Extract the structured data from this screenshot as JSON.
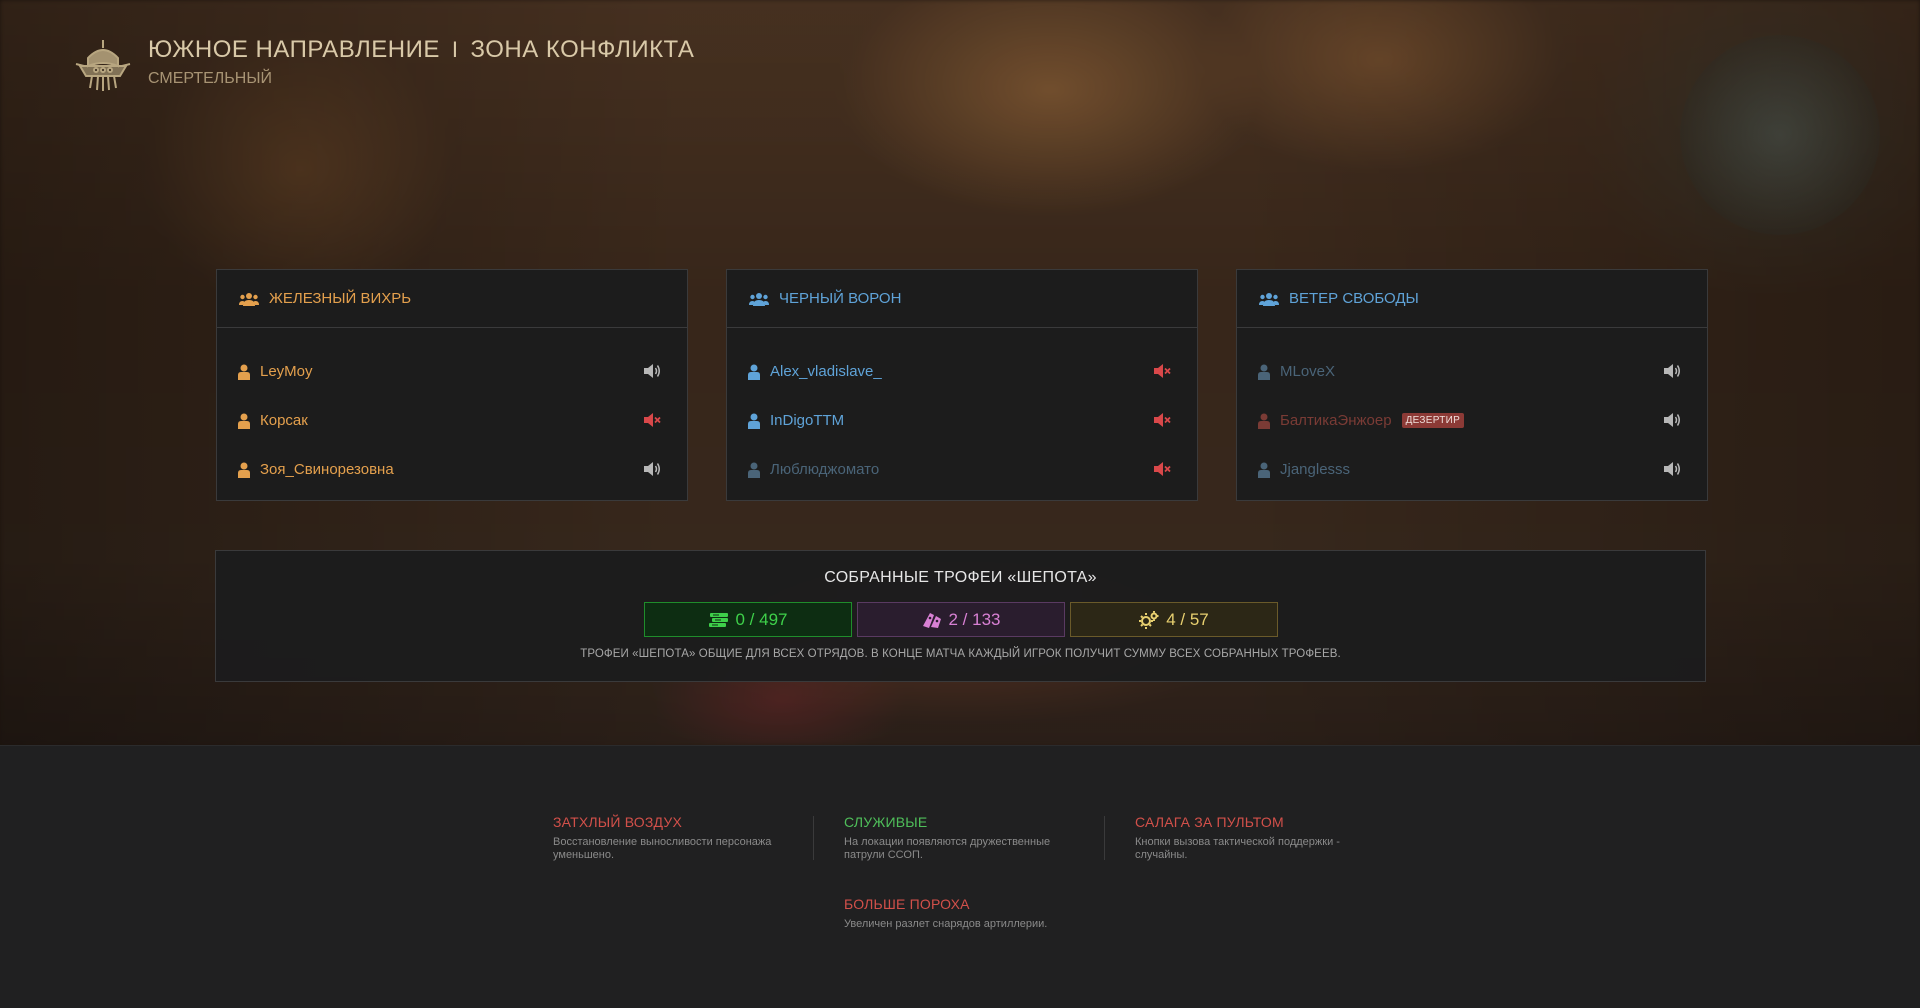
{
  "header": {
    "region": "ЮЖНОЕ НАПРАВЛЕНИЕ",
    "separator": "I",
    "zone": "ЗОНА КОНФЛИКТА",
    "difficulty": "СМЕРТЕЛЬНЫЙ",
    "logo_icon": "skull-helmet-emblem-icon"
  },
  "squads": [
    {
      "name": "ЖЕЛЕЗНЫЙ ВИХРЬ",
      "color": "#e4a04d",
      "players": [
        {
          "name": "LeyMoy",
          "voice": "speaker-on-icon"
        },
        {
          "name": "Корсак",
          "voice": "speaker-muted-icon"
        },
        {
          "name": "Зоя_Свинорезовна",
          "voice": "speaker-on-icon"
        }
      ]
    },
    {
      "name": "ЧЕРНЫЙ ВОРОН",
      "color": "#5fa3d8",
      "players": [
        {
          "name": "Alex_vladislave_",
          "voice": "speaker-muted-icon"
        },
        {
          "name": "InDigoTTM",
          "voice": "speaker-muted-icon"
        },
        {
          "name": "Люблюджомато",
          "voice": "speaker-muted-icon"
        }
      ]
    },
    {
      "name": "ВЕТЕР СВОБОДЫ",
      "color": "#5fa3d8",
      "players": [
        {
          "name": "MLoveX",
          "voice": "speaker-on-icon"
        },
        {
          "name": "БалтикаЭнжоер",
          "voice": "speaker-on-icon",
          "badge": "ДЕЗЕРТИР"
        },
        {
          "name": "Jjanglesss",
          "voice": "speaker-on-icon"
        }
      ]
    }
  ],
  "trophies": {
    "title": "СОБРАННЫЕ ТРОФЕИ «ШЕПОТА»",
    "counters": [
      {
        "value": "0 / 497",
        "icon": "scrap-stack-icon",
        "color": "#3ed04a"
      },
      {
        "value": "2 / 133",
        "icon": "pink-component-icon",
        "color": "#d880d4"
      },
      {
        "value": "4 / 57",
        "icon": "gear-part-icon",
        "color": "#e8d070"
      }
    ],
    "note": "ТРОФЕИ «ШЕПОТА» ОБЩИЕ ДЛЯ ВСЕХ ОТРЯДОВ. В КОНЦЕ МАТЧА КАЖДЫЙ ИГРОК ПОЛУЧИТ СУММУ ВСЕХ СОБРАННЫХ ТРОФЕЕВ."
  },
  "modifiers": [
    {
      "title": "ЗАТХЛЫЙ ВОЗДУХ",
      "desc": "Восстановление выносливости персонажа уменьшено.",
      "color": "#d2504a"
    },
    {
      "title": "СЛУЖИВЫЕ",
      "desc": "На локации появляются дружественные патрули ССОП.",
      "color": "#4fbf5a"
    },
    {
      "title": "САЛАГА ЗА ПУЛЬТОМ",
      "desc": "Кнопки вызова тактической поддержки - случайны.",
      "color": "#d2504a"
    },
    {
      "title": "БОЛЬШЕ ПОРОХА",
      "desc": "Увеличен разлет снарядов артиллерии.",
      "color": "#d2504a"
    }
  ]
}
